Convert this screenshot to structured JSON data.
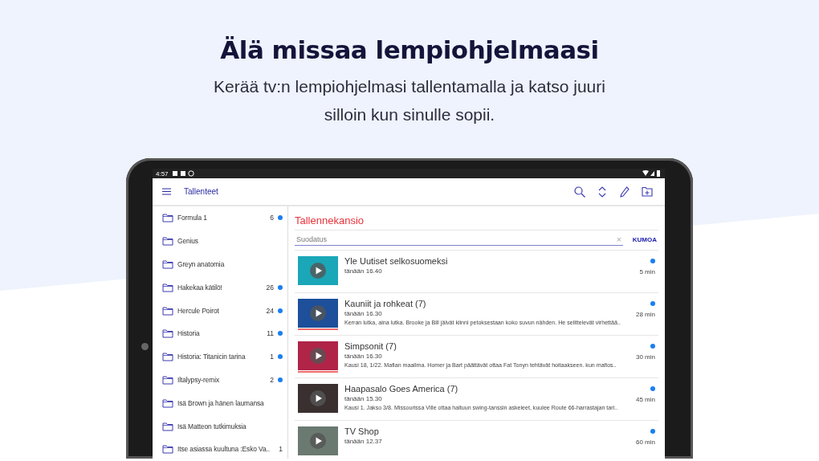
{
  "headline": "Älä missaa lempiohjelmaasi",
  "subtitle": "Kerää tv:n lempiohjelmasi tallentamalla ja katso juuri silloin kun sinulle sopii.",
  "status_bar": {
    "time": "4:57"
  },
  "app_bar": {
    "title": "Tallenteet"
  },
  "sidebar": {
    "items": [
      {
        "label": "Formula 1",
        "count": "6",
        "new": true
      },
      {
        "label": "Genius",
        "new": false
      },
      {
        "label": "Greyn anatomia",
        "new": false
      },
      {
        "label": "Hakekaa kätilö!",
        "count": "26",
        "new": true
      },
      {
        "label": "Hercule Poirot",
        "count": "24",
        "new": true
      },
      {
        "label": "Historia",
        "count": "11",
        "new": true
      },
      {
        "label": "Historia: Titanicin tarina",
        "count": "1",
        "new": true
      },
      {
        "label": "Iltalypsy-remix",
        "count": "2",
        "new": true
      },
      {
        "label": "Isä Brown ja hänen laumansa",
        "new": false
      },
      {
        "label": "Isä Matteon tutkimuksia",
        "new": false
      },
      {
        "label": "Itse asiassa kuultuna :Esko Va..",
        "count": "1",
        "new": false
      }
    ]
  },
  "folder": {
    "title": "Tallennekansio",
    "filter": {
      "placeholder": "Suodatus",
      "clear": "×"
    },
    "cancel": "KUMOA"
  },
  "recordings": [
    {
      "title": "Yle Uutiset selkosuomeksi",
      "time": "tänään 16.40",
      "duration": "5 min",
      "new": true
    },
    {
      "title": "Kauniit ja rohkeat (7)",
      "time": "tänään 16.30",
      "duration": "28 min",
      "description": "Kerran lutka, aina lutka. Brooke ja Bill jäivät kiinni petoksestaan koko suvun nähden. He selittelevät virhettää..",
      "new": true,
      "level": 1
    },
    {
      "title": "Simpsonit (7)",
      "time": "tänään 16.30",
      "duration": "30 min",
      "description": "Kausi 18, 1/22. Mafian maailma. Homer ja Bart päättävät ottaa Fat Tonyn tehtävät hoitaakseen. kun mafios..",
      "new": true,
      "level": 1
    },
    {
      "title": "Haapasalo Goes America (7)",
      "time": "tänään 15.30",
      "duration": "45 min",
      "description": "Kausi 1. Jakso 3/8. Missourissa Ville ottaa haltuun swing-tanssin askeleet, kuulee Route 66-harrastajan tari..",
      "new": true
    },
    {
      "title": "TV Shop",
      "time": "tänään 12.37",
      "duration": "60 min",
      "new": true
    }
  ]
}
